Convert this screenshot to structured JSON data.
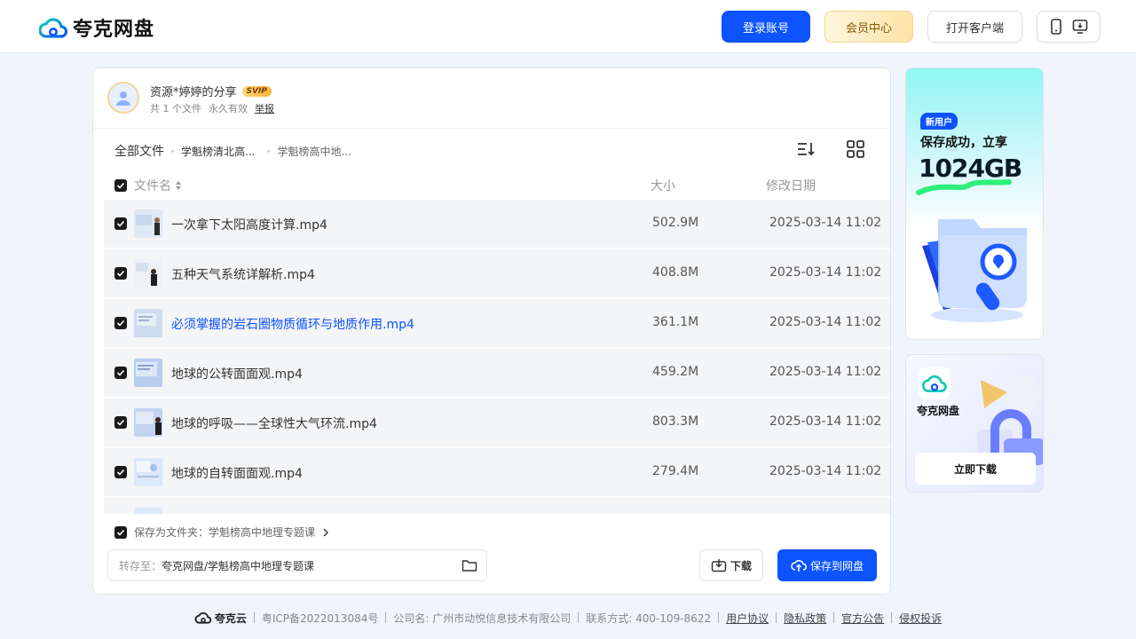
{
  "header": {
    "brand": "夸克网盘",
    "login_label": "登录账号",
    "vip_label": "会员中心",
    "client_label": "打开客户端"
  },
  "share": {
    "title": "资源*婷婷的分享",
    "badge": "SVIP",
    "file_count": "共 1 个文件",
    "validity": "永久有效",
    "report": "举报"
  },
  "breadcrumb": {
    "root": "全部文件",
    "mid": "学魁榜清北高...",
    "last": "学魁榜高中地..."
  },
  "columns": {
    "name": "文件名",
    "size": "大小",
    "date": "修改日期"
  },
  "files": [
    {
      "name": "一次拿下太阳高度计算.mp4",
      "size": "502.9M",
      "date": "2025-03-14 11:02"
    },
    {
      "name": "五种天气系统详解析.mp4",
      "size": "408.8M",
      "date": "2025-03-14 11:02"
    },
    {
      "name": "必须掌握的岩石圈物质循环与地质作用.mp4",
      "size": "361.1M",
      "date": "2025-03-14 11:02"
    },
    {
      "name": "地球的公转面面观.mp4",
      "size": "459.2M",
      "date": "2025-03-14 11:02"
    },
    {
      "name": "地球的呼吸——全球性大气环流.mp4",
      "size": "803.3M",
      "date": "2025-03-14 11:02"
    },
    {
      "name": "地球的自转面面观.mp4",
      "size": "279.4M",
      "date": "2025-03-14 11:02"
    }
  ],
  "bottom": {
    "save_as_folder": "保存为文件夹：学魁榜高中地理专题课",
    "dest_label": "转存至：",
    "dest_path": "夸克网盘/学魁榜高中地理专题课",
    "download_label": "下载",
    "save_label": "保存到网盘"
  },
  "ads": {
    "promo_badge": "新用户",
    "promo_line": "保存成功，立享",
    "promo_big": "1024GB",
    "app_name": "夸克网盘",
    "download_btn": "立即下载"
  },
  "footer": {
    "brand": "夸克云",
    "icp": "粤ICP备2022013084号",
    "company": "公司名: 广州市动悦信息技术有限公司",
    "contact": "联系方式: 400-109-8622",
    "links": [
      "用户协议",
      "隐私政策",
      "官方公告",
      "侵权投诉"
    ]
  },
  "colors": {
    "accent": "#0d53ff",
    "highlight_text": "#0d53ff"
  }
}
